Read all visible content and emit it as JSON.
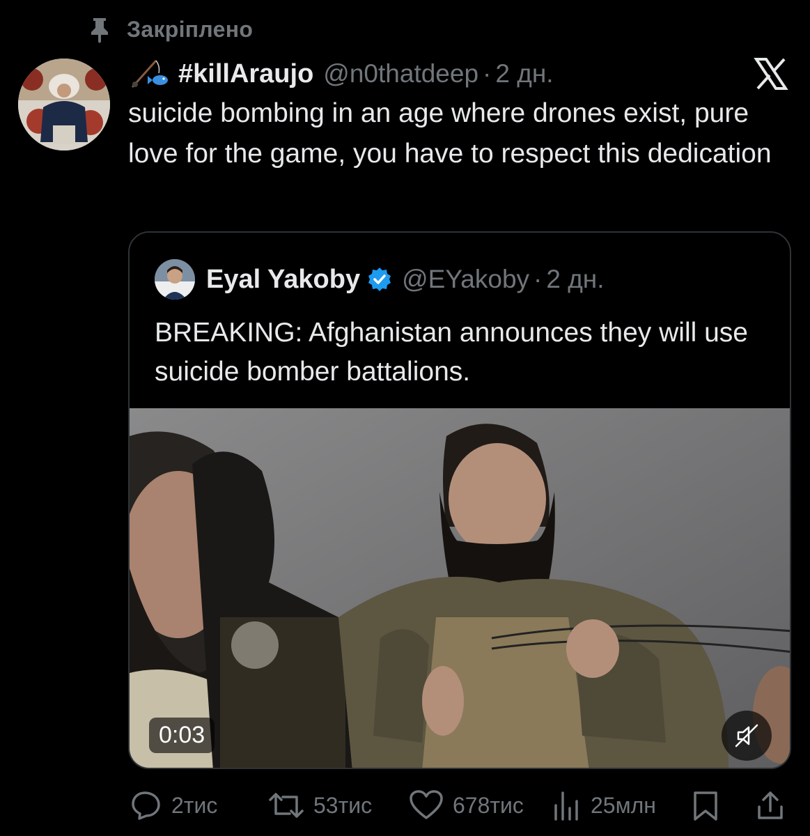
{
  "pinned": {
    "label": "Закріплено",
    "icon": "pin-icon"
  },
  "tweet": {
    "display_name": "#killAraujo",
    "name_emoji_icon": "fishing-pole-icon",
    "handle": "@n0thatdeep",
    "separator": "·",
    "time": "2 дн.",
    "text": "suicide bombing in an age where drones exist, pure love for the game, you have to respect this dedication",
    "platform_icon": "x-logo-icon"
  },
  "quote": {
    "display_name": "Eyal Yakoby",
    "verified_icon": "verified-badge-icon",
    "handle": "@EYakoby",
    "separator": "·",
    "time": "2 дн.",
    "text": "BREAKING: Afghanistan announces they will use suicide bomber battalions.",
    "video": {
      "duration": "0:03",
      "muted": true
    }
  },
  "actions": {
    "replies": "2тис",
    "reposts": "53тис",
    "likes": "678тис",
    "views": "25млн"
  },
  "colors": {
    "background": "#000000",
    "text": "#e7e9ea",
    "secondary": "#71767b",
    "border": "#2f3336",
    "verified": "#1d9bf0"
  }
}
